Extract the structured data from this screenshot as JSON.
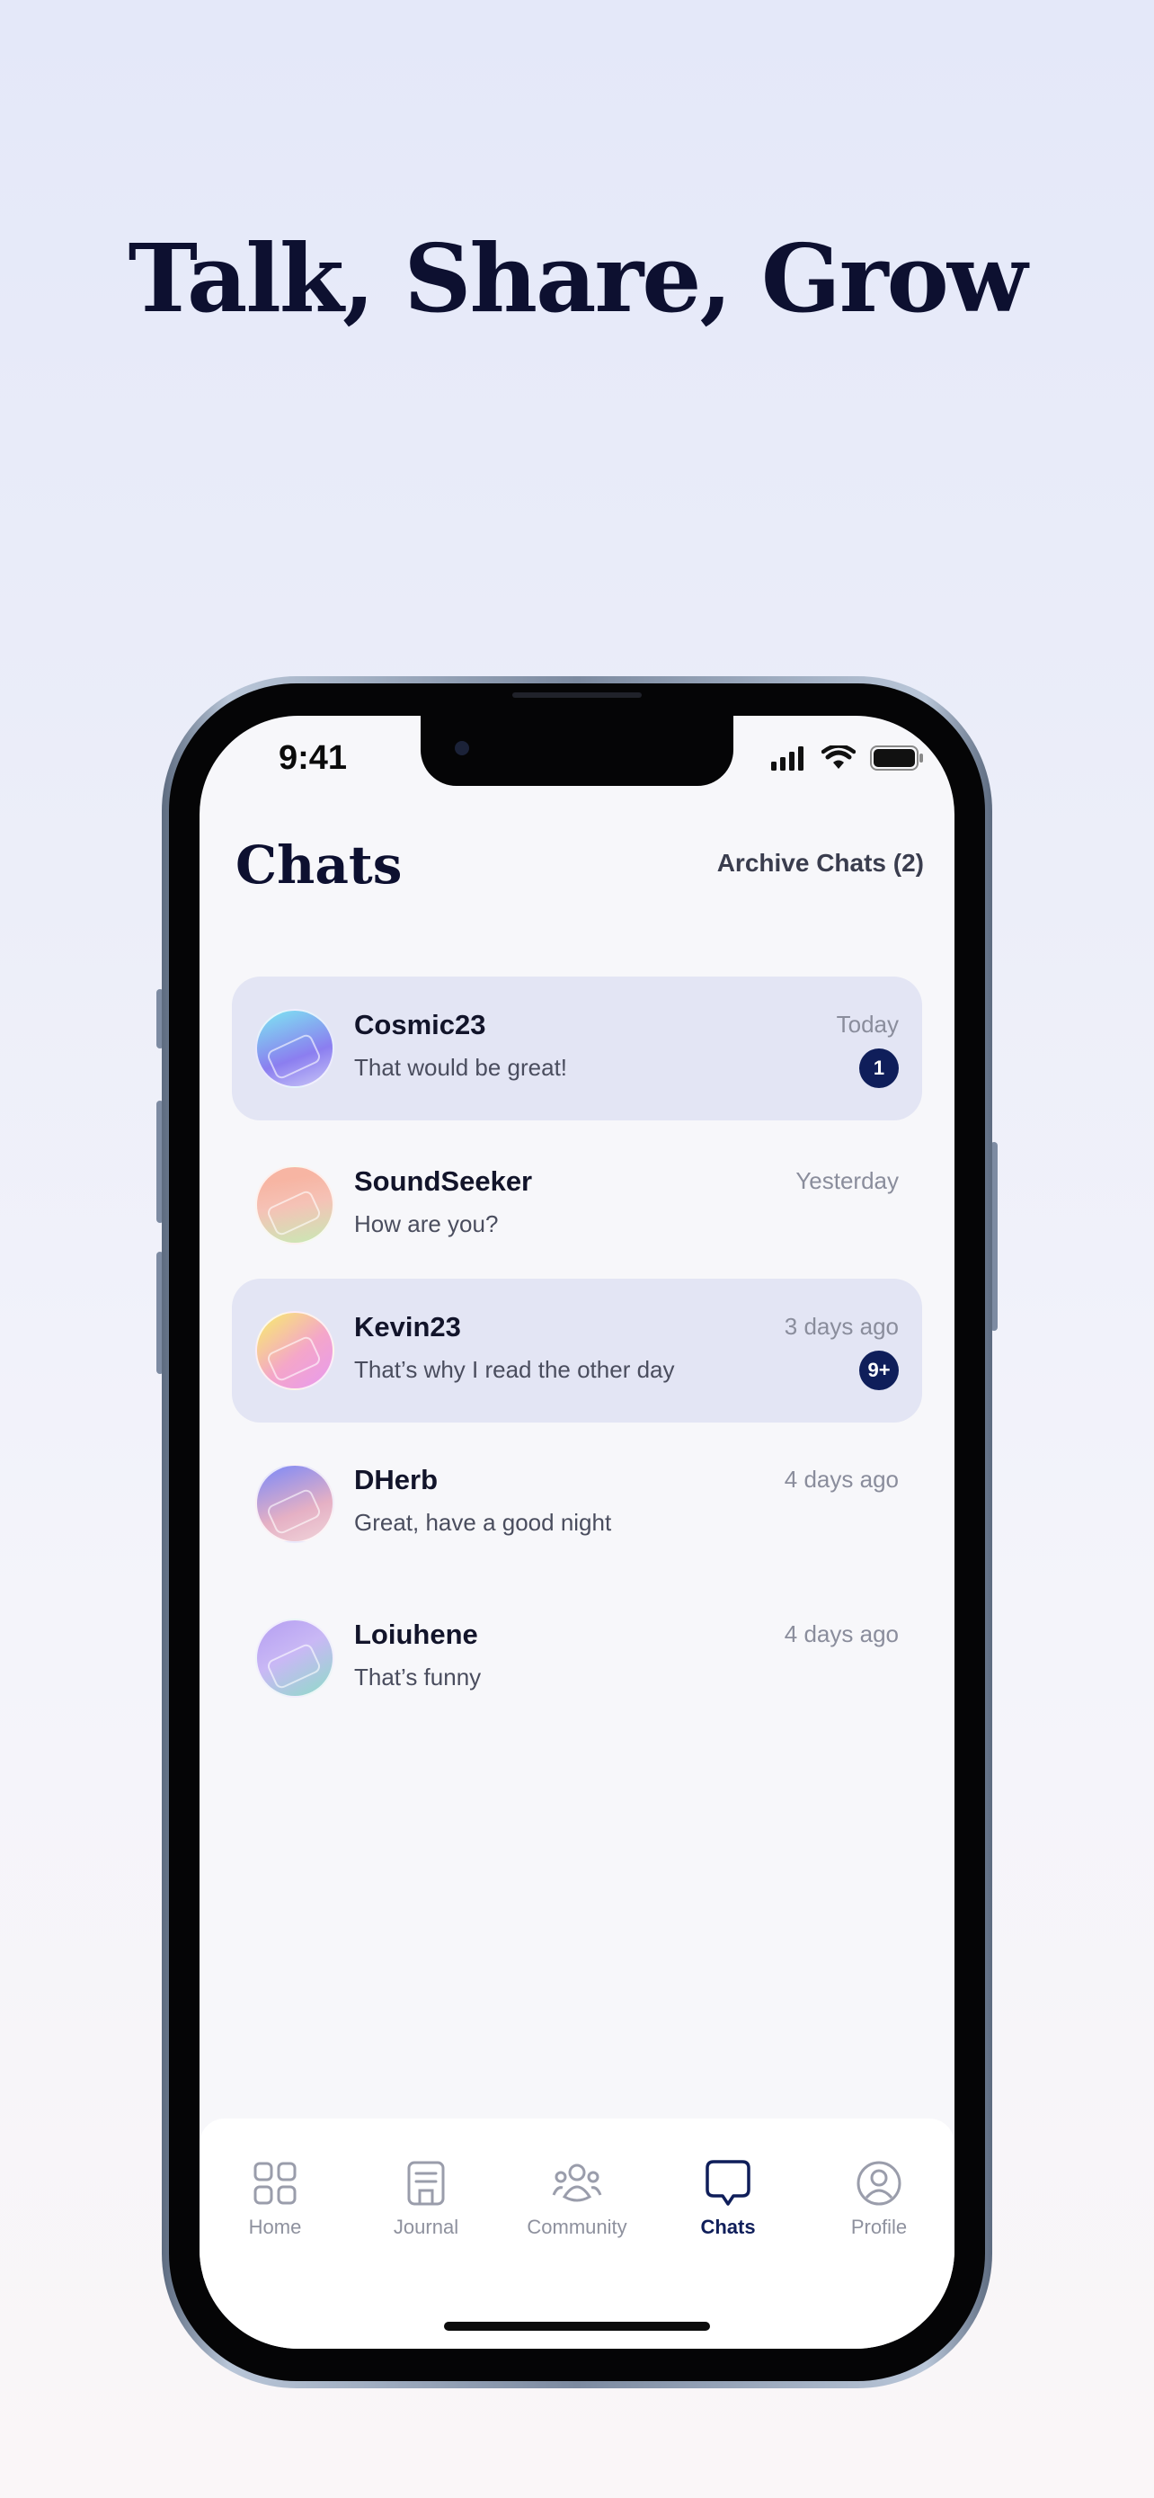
{
  "headline": "Talk, Share, Grow",
  "status_bar": {
    "time": "9:41"
  },
  "header": {
    "title": "Chats",
    "archive_label": "Archive Chats (2)"
  },
  "chats": [
    {
      "name": "Cosmic23",
      "preview": "That would be great!",
      "time": "Today",
      "unread": "1",
      "highlighted": true,
      "avatar_colors": [
        "#7fd6f1",
        "#8b7ef0",
        "#c9c7f7"
      ]
    },
    {
      "name": "SoundSeeker",
      "preview": "How are you?",
      "time": "Yesterday",
      "unread": null,
      "highlighted": false,
      "avatar_colors": [
        "#f7b5a3",
        "#f5c2b6",
        "#c8e9b4"
      ]
    },
    {
      "name": "Kevin23",
      "preview": "That’s why I read the other day",
      "time": "3 days ago",
      "unread": "9+",
      "highlighted": true,
      "avatar_colors": [
        "#f7e27a",
        "#f4a6c9",
        "#e79af0"
      ]
    },
    {
      "name": "DHerb",
      "preview": "Great, have a good night",
      "time": "4 days ago",
      "unread": null,
      "highlighted": false,
      "avatar_colors": [
        "#8c8ff0",
        "#e5b0c4",
        "#f0d4da"
      ]
    },
    {
      "name": "Loiuhene",
      "preview": "That’s funny",
      "time": "4 days ago",
      "unread": null,
      "highlighted": false,
      "avatar_colors": [
        "#b9a4f2",
        "#8ddcc7",
        "#d3c9f5"
      ]
    }
  ],
  "tabs": [
    {
      "label": "Home",
      "icon": "grid-icon",
      "active": false
    },
    {
      "label": "Journal",
      "icon": "journal-icon",
      "active": false
    },
    {
      "label": "Community",
      "icon": "community-icon",
      "active": false
    },
    {
      "label": "Chats",
      "icon": "chat-bubble-icon",
      "active": true
    },
    {
      "label": "Profile",
      "icon": "profile-icon",
      "active": false
    }
  ],
  "colors": {
    "accent": "#0f1e5a",
    "highlight_row": "#e3e5f4",
    "headline": "#0d1030"
  }
}
